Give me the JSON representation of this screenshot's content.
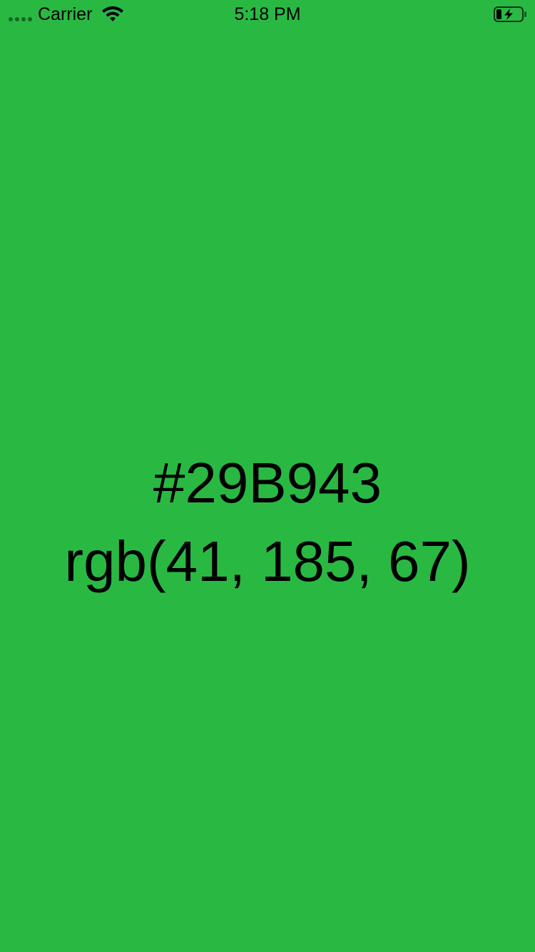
{
  "status_bar": {
    "carrier": "Carrier",
    "time": "5:18 PM",
    "signal_icon": "signal-dots-icon",
    "wifi_icon": "wifi-icon",
    "battery_icon": "battery-charging-icon"
  },
  "color": {
    "hex": "#29B943",
    "rgb": "rgb(41, 185, 67)",
    "background": "#29B943"
  }
}
